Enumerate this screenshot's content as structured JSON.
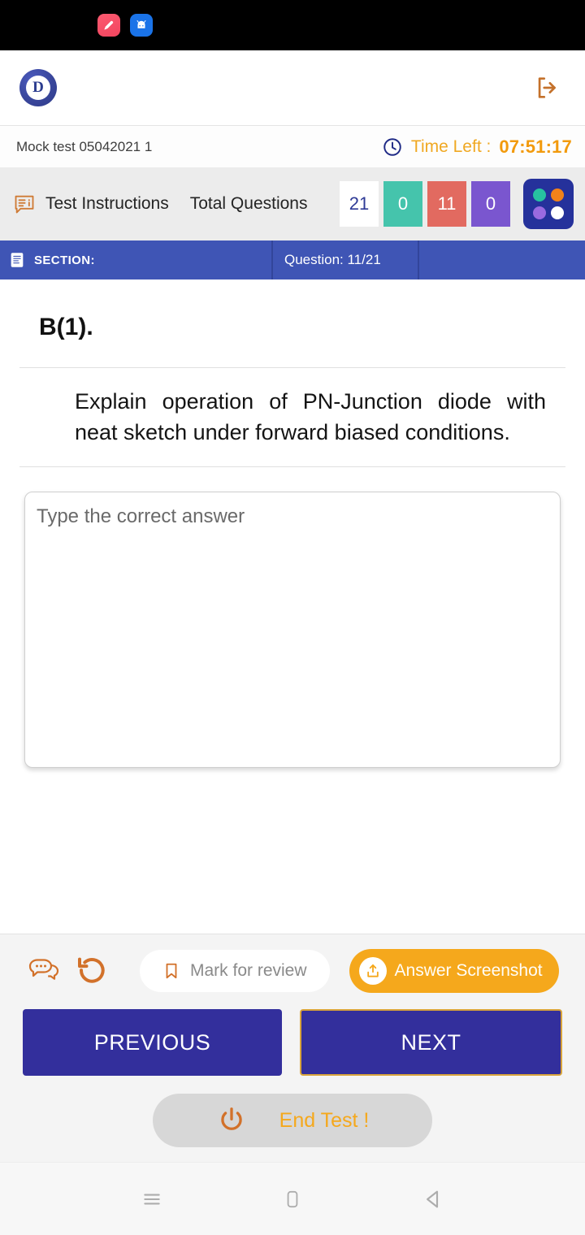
{
  "statusbar": {
    "icons": [
      {
        "name": "notification-app-pink",
        "glyph": "pink-app-icon"
      },
      {
        "name": "notification-app-android",
        "glyph": "android-robot-icon"
      }
    ]
  },
  "header": {
    "logo_letter": "D",
    "logo_name": "app-logo",
    "logout_icon": "logout-icon"
  },
  "testinfo": {
    "title": "Mock test 05042021 1",
    "clock_icon": "clock-icon",
    "time_label": "Time Left :",
    "time_value": "07:51:17"
  },
  "toolbar": {
    "instructions_icon": "test-instructions-icon",
    "instructions_label": "Test Instructions",
    "total_questions_label": "Total Questions",
    "counters": [
      {
        "name": "total-count",
        "value": "21",
        "color": "#ffffff",
        "text_color": "#2e3a96"
      },
      {
        "name": "answered-count",
        "value": "0",
        "color": "#45c4ac",
        "text_color": "#ffffff"
      },
      {
        "name": "not-answered-count",
        "value": "11",
        "color": "#e26a60",
        "text_color": "#ffffff"
      },
      {
        "name": "marked-count",
        "value": "0",
        "color": "#7a56cf",
        "text_color": "#ffffff"
      }
    ],
    "palette_icon": "question-palette-icon",
    "palette_dots": [
      "#27c2a0",
      "#f2821a",
      "#9a6ae0",
      "#ffffff"
    ]
  },
  "sectionbar": {
    "section_icon": "section-document-icon",
    "section_label": "SECTION:",
    "question_label": "Question: 11/21"
  },
  "question": {
    "number": "B(1).",
    "text": "Explain operation of PN-Junction diode with neat sketch under forward biased conditions."
  },
  "answer": {
    "placeholder": "Type the correct answer",
    "value": ""
  },
  "actions": {
    "chat_icon": "chat-bubbles-icon",
    "reset_icon": "reset-undo-icon",
    "mark_icon": "bookmark-icon",
    "mark_label": "Mark for review",
    "screenshot_icon": "upload-screenshot-icon",
    "screenshot_label": "Answer Screenshot",
    "previous_label": "PREVIOUS",
    "next_label": "NEXT",
    "end_icon": "power-icon",
    "end_label": "End Test !"
  },
  "androidnav": {
    "recents_icon": "recents-icon",
    "home_icon": "home-icon",
    "back_icon": "back-icon"
  },
  "colors": {
    "section_blue": "#3f55b5",
    "nav_indigo": "#332f9c",
    "accent_orange": "#f5a81c",
    "timer_orange": "#f29a0c",
    "icon_orange": "#d2712a"
  }
}
